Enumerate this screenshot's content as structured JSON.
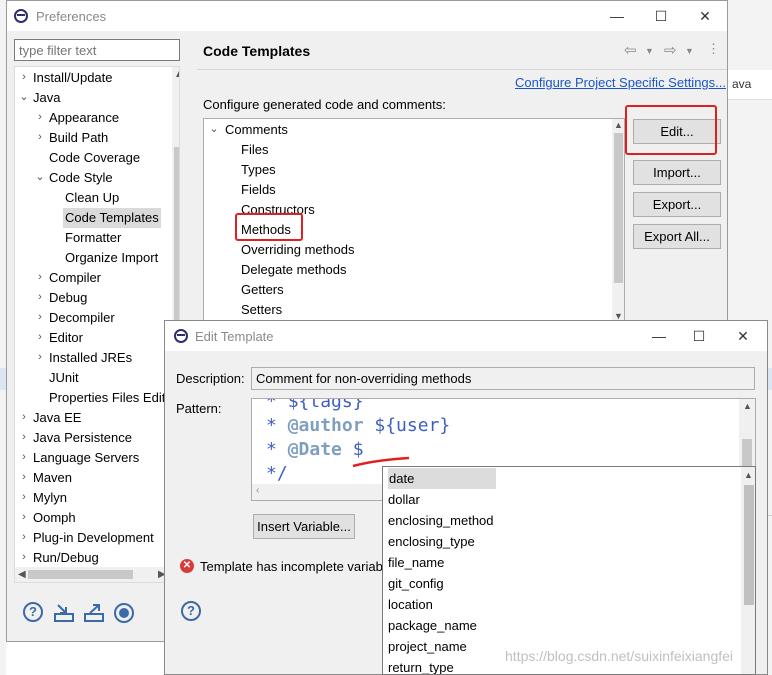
{
  "background": {
    "right_tab_label": "ava"
  },
  "preferences": {
    "title": "Preferences",
    "controls": {
      "minimize": "—",
      "maximize": "☐",
      "close": "✕"
    },
    "filter_placeholder": "type filter text",
    "tree": [
      {
        "label": "Install/Update",
        "arrow": "›"
      },
      {
        "label": "Java",
        "arrow": "⌄"
      },
      {
        "label": "Appearance",
        "arrow": "›"
      },
      {
        "label": "Build Path",
        "arrow": "›"
      },
      {
        "label": "Code Coverage",
        "arrow": ""
      },
      {
        "label": "Code Style",
        "arrow": "⌄"
      },
      {
        "label": "Clean Up",
        "arrow": ""
      },
      {
        "label": "Code Templates",
        "arrow": "",
        "selected": true
      },
      {
        "label": "Formatter",
        "arrow": ""
      },
      {
        "label": "Organize Import",
        "arrow": ""
      },
      {
        "label": "Compiler",
        "arrow": "›"
      },
      {
        "label": "Debug",
        "arrow": "›"
      },
      {
        "label": "Decompiler",
        "arrow": "›"
      },
      {
        "label": "Editor",
        "arrow": "›"
      },
      {
        "label": "Installed JREs",
        "arrow": "›"
      },
      {
        "label": "JUnit",
        "arrow": ""
      },
      {
        "label": "Properties Files Edit",
        "arrow": ""
      },
      {
        "label": "Java EE",
        "arrow": "›"
      },
      {
        "label": "Java Persistence",
        "arrow": "›"
      },
      {
        "label": "Language Servers",
        "arrow": "›"
      },
      {
        "label": "Maven",
        "arrow": "›"
      },
      {
        "label": "Mylyn",
        "arrow": "›"
      },
      {
        "label": "Oomph",
        "arrow": "›"
      },
      {
        "label": "Plug-in Development",
        "arrow": "›"
      },
      {
        "label": "Run/Debug",
        "arrow": "›"
      }
    ],
    "page_title": "Code Templates",
    "configure_link": "Configure Project Specific Settings...",
    "description": "Configure generated code and comments:",
    "templates": [
      {
        "label": "Comments",
        "arrow": "⌄"
      },
      {
        "label": "Files",
        "arrow": ""
      },
      {
        "label": "Types",
        "arrow": ""
      },
      {
        "label": "Fields",
        "arrow": ""
      },
      {
        "label": "Constructors",
        "arrow": ""
      },
      {
        "label": "Methods",
        "arrow": ""
      },
      {
        "label": "Overriding methods",
        "arrow": ""
      },
      {
        "label": "Delegate methods",
        "arrow": ""
      },
      {
        "label": "Getters",
        "arrow": ""
      },
      {
        "label": "Setters",
        "arrow": ""
      }
    ],
    "buttons": {
      "edit": "Edit...",
      "import": "Import...",
      "export": "Export...",
      "export_all": "Export All..."
    }
  },
  "edit_template": {
    "title": "Edit Template",
    "controls": {
      "minimize": "—",
      "maximize": "☐",
      "close": "✕"
    },
    "description_label": "Description:",
    "description_value": "Comment for non-overriding methods",
    "pattern_label": "Pattern:",
    "pattern_lines": [
      {
        "star": "* ",
        "kw": "",
        "rest": "${tags}"
      },
      {
        "star": "* ",
        "kw": "@author",
        "rest": " ${user}"
      },
      {
        "star": "* ",
        "kw": "@Date",
        "rest": " $"
      },
      {
        "star": "*/",
        "kw": "",
        "rest": ""
      }
    ],
    "insert_variable": "Insert Variable...",
    "error_text": "Template has incomplete variab",
    "help": "?"
  },
  "autocomplete": {
    "items": [
      "date",
      "dollar",
      "enclosing_method",
      "enclosing_type",
      "file_name",
      "git_config",
      "location",
      "package_name",
      "project_name",
      "return_type"
    ],
    "selected": "date"
  },
  "watermark": "https://blog.csdn.net/suixinfeixiangfei"
}
